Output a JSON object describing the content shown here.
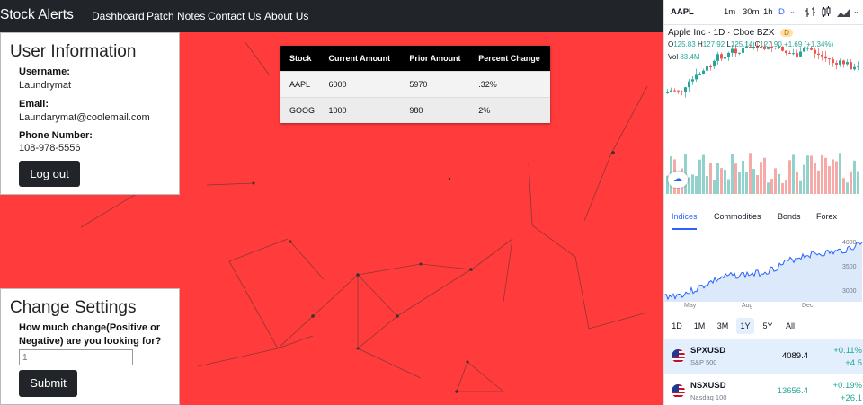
{
  "navbar": {
    "brand": "Stock Alerts",
    "links": [
      "Dashboard",
      "Patch Notes",
      "Contact Us",
      "About Us"
    ]
  },
  "user_info": {
    "title": "User Information",
    "username_label": "Username:",
    "username": "Laundrymat",
    "email_label": "Email:",
    "email": "Laundarymat@coolemail.com",
    "phone_label": "Phone Number:",
    "phone": "108-978-5556",
    "logout_label": "Log out"
  },
  "settings": {
    "title": "Change Settings",
    "question_line1": "How much change(Positive or",
    "question_line2": "Negative) are you looking for?",
    "input_placeholder": "1",
    "submit_label": "Submit"
  },
  "stock_table": {
    "headers": [
      "Stock",
      "Current Amount",
      "Prior Amount",
      "Percent Change"
    ],
    "rows": [
      [
        "AAPL",
        "6000",
        "5970",
        ".32%"
      ],
      [
        "GOOG",
        "1000",
        "980",
        "2%"
      ]
    ]
  },
  "tv_widget": {
    "symbol": "AAPL",
    "intervals": [
      "1m",
      "30m",
      "1h",
      "D"
    ],
    "active_interval": "D",
    "title": "Apple Inc · 1D · Cboe BZX",
    "badge": "D",
    "ohlc": {
      "o": "125.83",
      "h": "127.92",
      "l": "125.14",
      "c": "127.90",
      "chg": "+1.69 (+1.34%)"
    },
    "vol_label": "Vol",
    "vol_value": "83.4M",
    "up_color": "#26a69a",
    "down_color": "#ef5350",
    "icons": [
      "chevron-down-icon",
      "bar-chart-icon",
      "candles-icon",
      "area-chart-icon"
    ]
  },
  "market": {
    "tabs": [
      "Indices",
      "Commodities",
      "Bonds",
      "Forex"
    ],
    "active_tab": "Indices",
    "y_ticks": [
      "4000",
      "3500",
      "3000"
    ],
    "x_ticks": [
      "May",
      "Aug",
      "Dec"
    ],
    "ranges": [
      "1D",
      "1M",
      "3M",
      "1Y",
      "5Y",
      "All"
    ],
    "active_range": "1Y",
    "quotes": [
      {
        "symbol": "SPXUSD",
        "name": "S&P 500",
        "price": "4089.4",
        "change_pct": "+0.11%",
        "change": "+4.5"
      },
      {
        "symbol": "NSXUSD",
        "name": "Nasdaq 100",
        "price": "13656.4",
        "change_pct": "+0.19%",
        "change": "+26.1"
      }
    ]
  }
}
